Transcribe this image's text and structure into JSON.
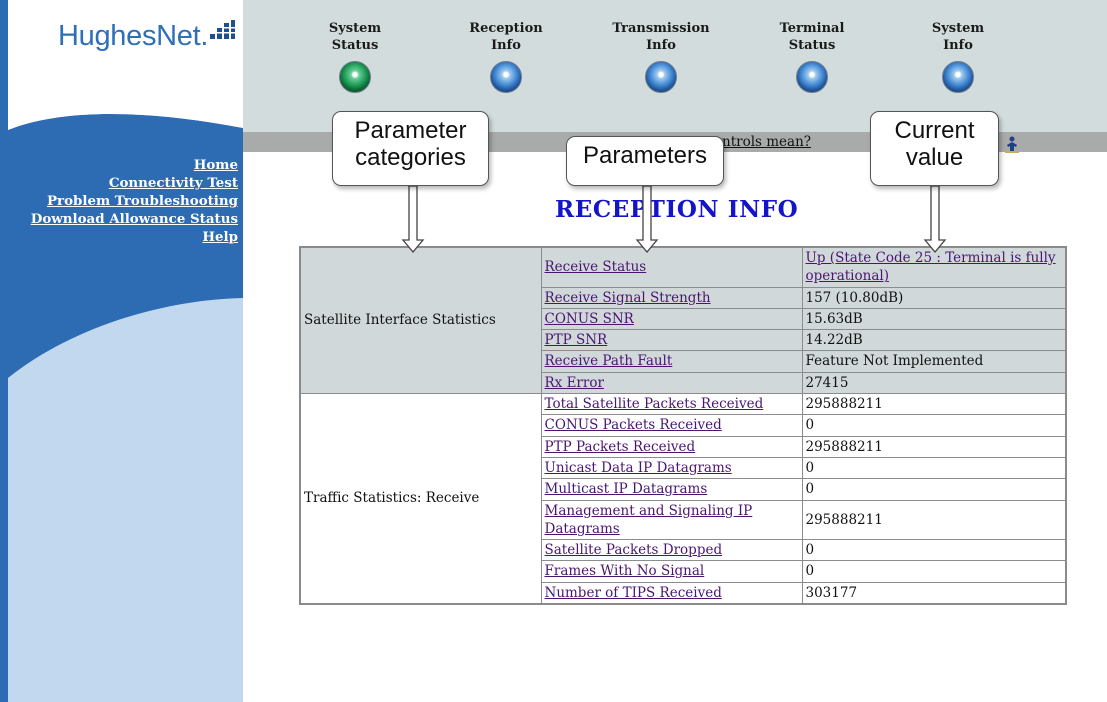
{
  "logo": {
    "text": "HughesNet."
  },
  "sidebar": {
    "links": [
      "Home",
      "Connectivity Test",
      "Problem Troubleshooting",
      "Download Allowance Status",
      "Help"
    ]
  },
  "tabs": [
    {
      "line1": "System",
      "line2": "Status",
      "state": "active"
    },
    {
      "line1": "Reception",
      "line2": "Info",
      "state": "inactive"
    },
    {
      "line1": "Transmission",
      "line2": "Info",
      "state": "inactive"
    },
    {
      "line1": "Terminal",
      "line2": "Status",
      "state": "inactive"
    },
    {
      "line1": "System",
      "line2": "Info",
      "state": "inactive"
    }
  ],
  "subbar": {
    "link_text": "ntrols mean?"
  },
  "page_title": "RECEPTION INFO",
  "callouts": {
    "categories": {
      "line1": "Parameter",
      "line2": "categories"
    },
    "parameters": {
      "line1": "Parameters"
    },
    "current": {
      "line1": "Current",
      "line2": "value"
    }
  },
  "groups": [
    {
      "category": "Satellite Interface Statistics",
      "rows": [
        {
          "param": "Receive Status",
          "value": "Up (State Code 25 : Terminal is fully operational)"
        },
        {
          "param": "Receive Signal Strength",
          "value": "157 (10.80dB)"
        },
        {
          "param": "CONUS SNR",
          "value": "15.63dB"
        },
        {
          "param": "PTP SNR",
          "value": "14.22dB"
        },
        {
          "param": "Receive Path Fault",
          "value": "Feature Not Implemented"
        },
        {
          "param": "Rx Error",
          "value": "27415"
        }
      ]
    },
    {
      "category": "Traffic Statistics: Receive",
      "rows": [
        {
          "param": "Total Satellite Packets Received",
          "value": "295888211"
        },
        {
          "param": "CONUS Packets Received",
          "value": "0"
        },
        {
          "param": "PTP Packets Received",
          "value": "295888211"
        },
        {
          "param": "Unicast Data IP Datagrams",
          "value": "0"
        },
        {
          "param": "Multicast IP Datagrams",
          "value": "0"
        },
        {
          "param": "Management and Signaling IP Datagrams",
          "value": "295888211"
        },
        {
          "param": "Satellite Packets Dropped",
          "value": "0"
        },
        {
          "param": "Frames With No Signal",
          "value": "0"
        },
        {
          "param": "Number of TIPS Received",
          "value": "303177"
        }
      ]
    }
  ]
}
